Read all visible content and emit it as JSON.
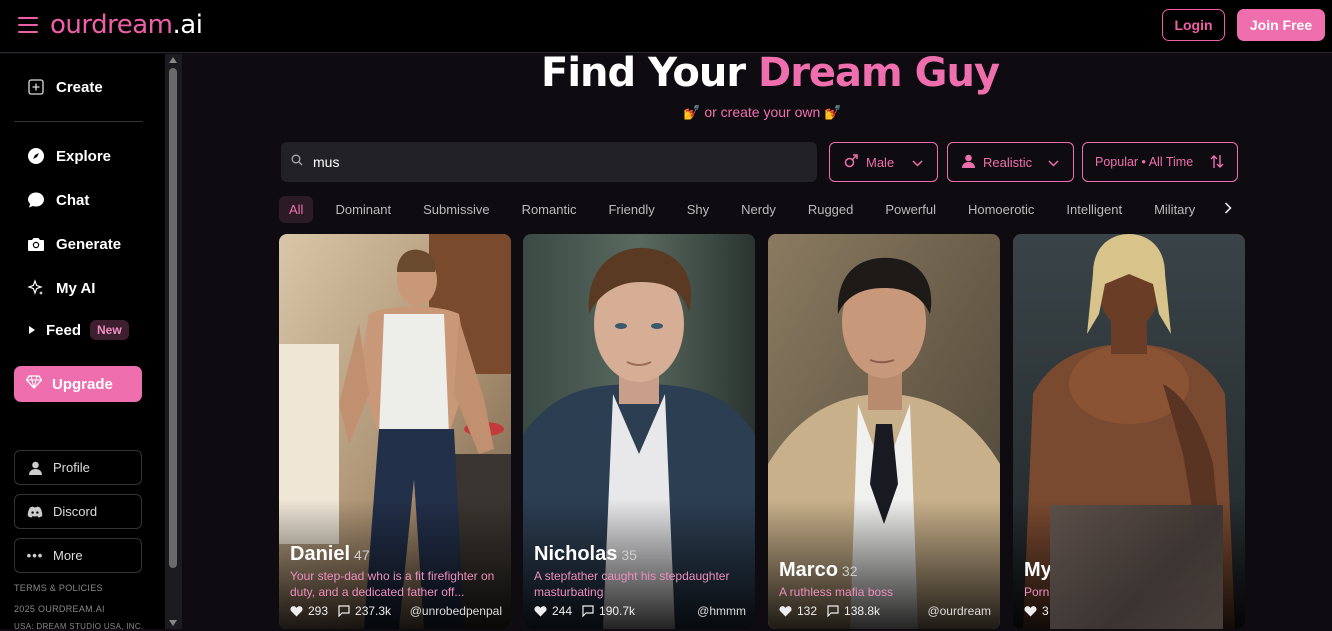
{
  "header": {
    "logo_main": "ourdream",
    "logo_suffix": ".ai",
    "login_label": "Login",
    "join_label": "Join Free"
  },
  "sidebar": {
    "create": "Create",
    "explore": "Explore",
    "chat": "Chat",
    "generate": "Generate",
    "my_ai": "My AI",
    "feed": "Feed",
    "feed_badge": "New",
    "upgrade": "Upgrade",
    "profile": "Profile",
    "discord": "Discord",
    "more": "More",
    "terms": "TERMS & POLICIES",
    "copyright": "2025 OURDREAM.AI",
    "company": "USA: DREAM STUDIO USA, INC."
  },
  "main": {
    "title_part1": "Find Your ",
    "title_part2": "Dream Guy",
    "subtitle": "💅 or create your own 💅",
    "search_value": "mus",
    "filters": {
      "gender": "Male",
      "style": "Realistic",
      "sort": "Popular • All Time"
    },
    "tags": [
      "All",
      "Dominant",
      "Submissive",
      "Romantic",
      "Friendly",
      "Shy",
      "Nerdy",
      "Rugged",
      "Powerful",
      "Homoerotic",
      "Intelligent",
      "Military"
    ]
  },
  "cards": [
    {
      "name": "Daniel",
      "age": "47",
      "desc": "Your step-dad who is a fit firefighter on duty, and a dedicated father off...",
      "likes": "293",
      "chats": "237.3k",
      "handle": "@unrobedpenpal"
    },
    {
      "name": "Nicholas",
      "age": "35",
      "desc": "A stepfather caught his stepdaughter masturbating",
      "likes": "244",
      "chats": "190.7k",
      "handle": "@hmmm"
    },
    {
      "name": "Marco",
      "age": "32",
      "desc": "A ruthless mafia boss",
      "likes": "132",
      "chats": "138.8k",
      "handle": "@ourdream"
    },
    {
      "name": "My",
      "desc": "Porn",
      "likes": "3"
    }
  ],
  "colors": {
    "accent": "#ef6fae",
    "background": "#0e0c10"
  }
}
